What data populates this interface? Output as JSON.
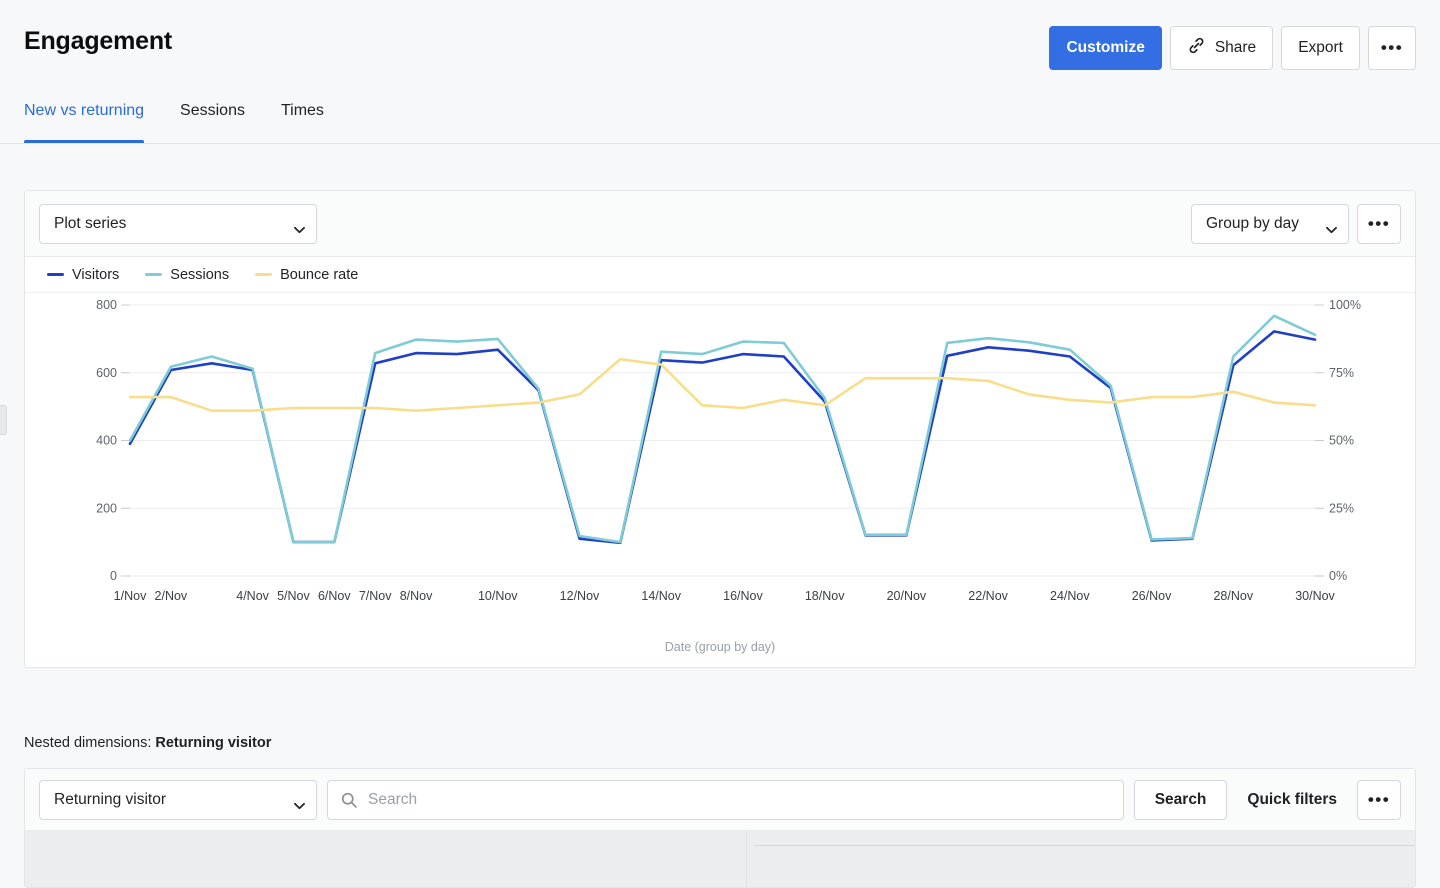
{
  "header": {
    "title": "Engagement",
    "actions": [
      {
        "label": "Customize",
        "name": "customize-button",
        "style": "primary"
      },
      {
        "label": "Share",
        "name": "share-button",
        "icon": "link-icon"
      },
      {
        "label": "Export",
        "name": "export-button"
      },
      {
        "label": "",
        "name": "more-options-button",
        "icon": "ellipsis-icon"
      }
    ]
  },
  "tabs": [
    {
      "label": "New vs returning",
      "active": true
    },
    {
      "label": "Sessions",
      "active": false
    },
    {
      "label": "Times",
      "active": false
    }
  ],
  "chart_toolbar": {
    "plot_series_label": "Plot series",
    "group_by_label": "Group by day",
    "more_label": ""
  },
  "table_toolbar": {
    "dimension_label": "Returning visitor",
    "search_placeholder": "Search",
    "search_value": "",
    "search_button": "Search",
    "quick_filters_button": "Quick filters",
    "more_label": ""
  },
  "nested": {
    "prefix": "Nested dimensions:",
    "value": "Returning visitor"
  },
  "colors": {
    "accent": "#336fe2",
    "tab_active": "#2a6bd8",
    "visitors": "#1f3fc4",
    "sessions": "#7fccd4",
    "bounce_rate": "#f8dd8a",
    "grid": "#ededef",
    "axis_text": "#5f6368"
  },
  "chart_data": {
    "type": "line",
    "title": "",
    "xlabel": "Date (group by day)",
    "ylabel": "",
    "grid": true,
    "legend_position": "top-left",
    "x": [
      "1/Nov",
      "2/Nov",
      "3/Nov",
      "4/Nov",
      "5/Nov",
      "6/Nov",
      "7/Nov",
      "8/Nov",
      "9/Nov",
      "10/Nov",
      "11/Nov",
      "12/Nov",
      "13/Nov",
      "14/Nov",
      "15/Nov",
      "16/Nov",
      "17/Nov",
      "18/Nov",
      "19/Nov",
      "20/Nov",
      "21/Nov",
      "22/Nov",
      "23/Nov",
      "24/Nov",
      "25/Nov",
      "26/Nov",
      "27/Nov",
      "28/Nov",
      "29/Nov",
      "30/Nov"
    ],
    "x_tick_labels": [
      "1/Nov",
      "2/Nov",
      "",
      "4/Nov",
      "5/Nov",
      "6/Nov",
      "7/Nov",
      "8/Nov",
      "",
      "10/Nov",
      "",
      "12/Nov",
      "",
      "14/Nov",
      "",
      "16/Nov",
      "",
      "18/Nov",
      "",
      "20/Nov",
      "",
      "22/Nov",
      "",
      "24/Nov",
      "",
      "26/Nov",
      "",
      "28/Nov",
      "",
      "30/Nov"
    ],
    "axes": {
      "left": {
        "ticks": [
          0,
          200,
          400,
          600,
          800
        ],
        "tick_labels": [
          "0",
          "200",
          "400",
          "600",
          "800"
        ],
        "min": 0,
        "max": 800
      },
      "right": {
        "ticks": [
          0,
          25,
          50,
          75,
          100
        ],
        "tick_labels": [
          "0%",
          "25%",
          "50%",
          "75%",
          "100%"
        ],
        "min": 0,
        "max": 100
      }
    },
    "series": [
      {
        "name": "Visitors",
        "axis": "left",
        "color": "#1f3fc4",
        "values": [
          390,
          608,
          628,
          608,
          100,
          100,
          628,
          658,
          655,
          668,
          548,
          110,
          98,
          637,
          630,
          655,
          648,
          515,
          120,
          120,
          650,
          675,
          665,
          648,
          555,
          105,
          110,
          622,
          722,
          698
        ]
      },
      {
        "name": "Sessions",
        "axis": "left",
        "color": "#7fccd4",
        "values": [
          400,
          618,
          648,
          612,
          100,
          100,
          658,
          698,
          692,
          700,
          552,
          118,
          100,
          662,
          655,
          692,
          688,
          525,
          122,
          122,
          688,
          702,
          690,
          668,
          562,
          108,
          112,
          648,
          768,
          712
        ]
      },
      {
        "name": "Bounce rate",
        "axis": "right",
        "color": "#f8dd8a",
        "values": [
          66,
          66,
          61,
          61,
          62,
          62,
          62,
          61,
          62,
          63,
          64,
          67,
          80,
          78,
          63,
          62,
          65,
          63,
          73,
          73,
          73,
          72,
          67,
          65,
          64,
          66,
          66,
          68,
          64,
          63
        ]
      }
    ]
  }
}
